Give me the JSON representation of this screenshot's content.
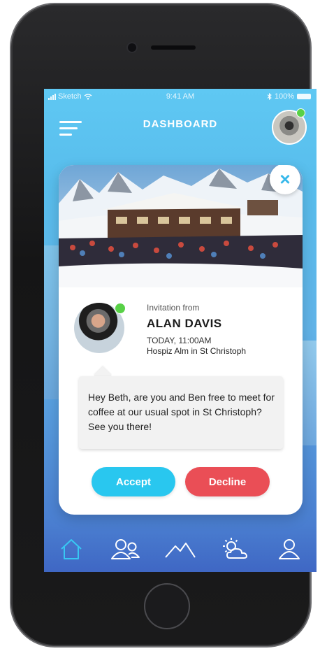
{
  "status_bar": {
    "carrier": "Sketch",
    "time": "9:41 AM",
    "battery": "100%"
  },
  "header": {
    "title": "DASHBOARD",
    "menu_icon": "hamburger-icon",
    "avatar_online": true
  },
  "invitation": {
    "photo": "ski-lodge-photo",
    "label": "Invitation from",
    "sender_name": "ALAN DAVIS",
    "time": "TODAY, 11:00AM",
    "place": "Hospiz Alm in St Christoph",
    "sender_online": true,
    "message": "Hey Beth, are you and Ben free to meet for coffee at our usual spot in St Christoph? See you there!",
    "accept_label": "Accept",
    "decline_label": "Decline"
  },
  "tabs": [
    {
      "icon": "home-icon",
      "active": true
    },
    {
      "icon": "friends-icon",
      "active": false
    },
    {
      "icon": "mountain-icon",
      "active": false
    },
    {
      "icon": "weather-icon",
      "active": false
    },
    {
      "icon": "profile-icon",
      "active": false
    }
  ],
  "colors": {
    "accent": "#29c7ef",
    "decline": "#ea4e56",
    "online": "#58d147",
    "active_tab": "#38c8f3"
  }
}
